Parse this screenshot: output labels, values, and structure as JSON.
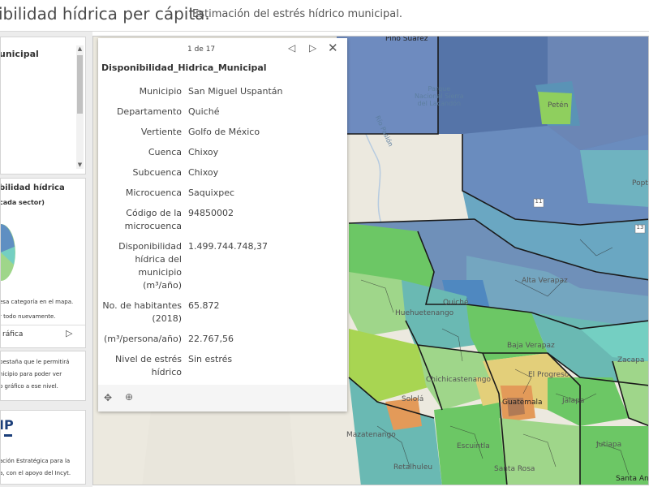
{
  "header": {
    "title": "ibilidad hídrica per cápita.",
    "subtitle": "Estimación del estrés hídrico municipal."
  },
  "sidebar": {
    "card1": {
      "title": "unicipal"
    },
    "card2": {
      "title": "bilidad hídrica",
      "subtitle": "cada sector)",
      "note1": "esa categoría en el mapa.",
      "note2": "r todo nuevamente.",
      "tab_label": "ráfica"
    },
    "card3": {
      "line1": "pestaña que le permitirá",
      "line2": "nicipio para poder ver",
      "line3": "o gráfico a ese nivel."
    },
    "card4": {
      "logo": "IP",
      "line1": "ación Estratégica para la",
      "line2": "a, con el apoyo del Incyt."
    }
  },
  "popup": {
    "counter": "1 de 17",
    "title": "Disponibilidad_Hidrica_Municipal",
    "fields": [
      {
        "label": "Municipio",
        "value": "San Miguel Uspantán"
      },
      {
        "label": "Departamento",
        "value": "Quiché"
      },
      {
        "label": "Vertiente",
        "value": "Golfo de México"
      },
      {
        "label": "Cuenca",
        "value": "Chixoy"
      },
      {
        "label": "Subcuenca",
        "value": "Chixoy"
      },
      {
        "label": "Microcuenca",
        "value": "Saquixpec"
      },
      {
        "label": "Código de la microcuenca",
        "value": "94850002"
      },
      {
        "label": "Disponibilidad hídrica del municipio (m³/año)",
        "value": "1.499.744.748,37"
      },
      {
        "label": "No. de habitantes (2018)",
        "value": "65.872"
      },
      {
        "label": "(m³/persona/año)",
        "value": "22.767,56"
      },
      {
        "label": "Nivel de estrés hídrico",
        "value": "Sin estrés"
      }
    ],
    "footer_icons": [
      "move-icon",
      "zoom-in-icon"
    ]
  },
  "map": {
    "labels": {
      "pino_suarez": "Pino Suárez",
      "parque_line1": "Parque",
      "parque_line2": "Nacional Sierra",
      "parque_line3": "del Lacandón",
      "peten": "Petén",
      "rio_pasion": "Río Pasión",
      "poptun": "Poptún",
      "alta_verapaz": "Alta Verapaz",
      "baja_verapaz": "Baja Verapaz",
      "quiche": "Quiché",
      "huehuetenango": "Huehuetenango",
      "chichicastenango": "Chichicastenango",
      "guatemala": "Guatemala",
      "el_progreso": "El Progreso",
      "jalapa": "Jalapa",
      "zacapa": "Zacapa",
      "escuintla": "Escuintla",
      "santa_rosa": "Santa Rosa",
      "jutiapa": "Jutiapa",
      "mazatenango": "Mazatenango",
      "retalhuleu": "Retalhuleu",
      "solola": "Sololá",
      "santa_ana": "Santa Ana"
    },
    "road_shields": [
      "11",
      "13"
    ],
    "colors": {
      "base": "#ece9df",
      "blue_dark": "#5f79ad",
      "blue_mid": "#6f90b9",
      "teal": "#6ab9b3",
      "teal_light": "#74cfc2",
      "green": "#6cc765",
      "green_light": "#9fd68a",
      "lime": "#a8d552",
      "yellow": "#e3cf7a",
      "orange": "#e39a59",
      "brown": "#b07a55",
      "border": "#1a1a1a"
    }
  }
}
